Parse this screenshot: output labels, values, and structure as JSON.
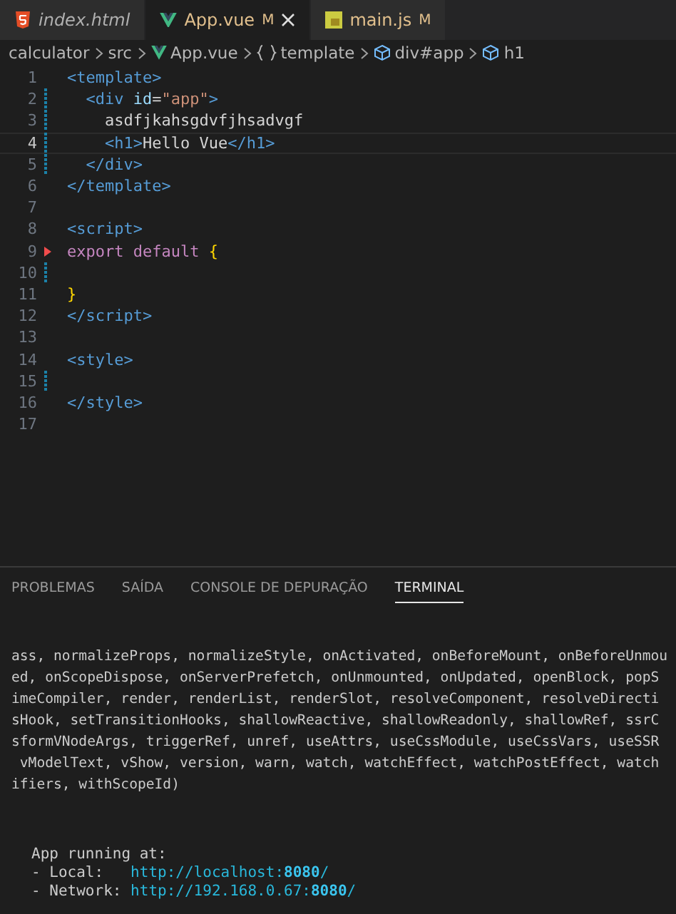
{
  "tabs": [
    {
      "label": "index.html",
      "kind": "html",
      "selected": false,
      "preview": true,
      "closable": false
    },
    {
      "label": "App.vue",
      "kind": "vue",
      "selected": true,
      "preview": false,
      "badge": "M",
      "closable": true
    },
    {
      "label": "main.js",
      "kind": "js",
      "selected": false,
      "preview": false,
      "badge": "M",
      "closable": false
    }
  ],
  "breadcrumb": [
    {
      "label": "calculator",
      "kind": "folder"
    },
    {
      "label": "src",
      "kind": "folder"
    },
    {
      "label": "App.vue",
      "kind": "vue"
    },
    {
      "label": "template",
      "kind": "braces"
    },
    {
      "label": "div#app",
      "kind": "cube"
    },
    {
      "label": "h1",
      "kind": "cube"
    }
  ],
  "code_lines": [
    {
      "number": "1",
      "current": false,
      "modified": false,
      "deleted": false,
      "tokens": [
        {
          "kind": "tag",
          "text": "<template>"
        }
      ]
    },
    {
      "number": "2",
      "current": false,
      "modified": true,
      "deleted": false,
      "tokens": [
        {
          "kind": "tag",
          "text": "  <div "
        },
        {
          "kind": "attr",
          "text": "id"
        },
        {
          "kind": "plain",
          "text": "="
        },
        {
          "kind": "string",
          "text": "\"app\""
        },
        {
          "kind": "tag",
          "text": ">"
        }
      ]
    },
    {
      "number": "3",
      "current": false,
      "modified": true,
      "deleted": false,
      "tokens": [
        {
          "kind": "plain",
          "text": "    asdfjkahsgdvfjhsadvgf"
        }
      ]
    },
    {
      "number": "4",
      "current": true,
      "modified": true,
      "deleted": false,
      "tokens": [
        {
          "kind": "tag",
          "text": "    <h1>"
        },
        {
          "kind": "plain",
          "text": "Hello Vue"
        },
        {
          "kind": "tag",
          "text": "</h1>"
        }
      ]
    },
    {
      "number": "5",
      "current": false,
      "modified": true,
      "deleted": false,
      "tokens": [
        {
          "kind": "tag",
          "text": "  </div>"
        }
      ]
    },
    {
      "number": "6",
      "current": false,
      "modified": false,
      "deleted": false,
      "tokens": [
        {
          "kind": "tag",
          "text": "</template>"
        }
      ]
    },
    {
      "number": "7",
      "current": false,
      "modified": false,
      "deleted": false
    },
    {
      "number": "8",
      "current": false,
      "modified": false,
      "deleted": false,
      "tokens": [
        {
          "kind": "tag",
          "text": "<script>"
        }
      ]
    },
    {
      "number": "9",
      "current": false,
      "modified": false,
      "deleted": true,
      "tokens": [
        {
          "kind": "keyword",
          "text": "export default "
        },
        {
          "kind": "brace",
          "text": "{"
        }
      ]
    },
    {
      "number": "10",
      "current": false,
      "modified": true,
      "deleted": false
    },
    {
      "number": "11",
      "current": false,
      "modified": false,
      "deleted": false,
      "tokens": [
        {
          "kind": "brace",
          "text": "}"
        }
      ]
    },
    {
      "number": "12",
      "current": false,
      "modified": false,
      "deleted": false,
      "tokens": [
        {
          "kind": "tag",
          "text": "</script>"
        }
      ]
    },
    {
      "number": "13",
      "current": false,
      "modified": false,
      "deleted": false
    },
    {
      "number": "14",
      "current": false,
      "modified": false,
      "deleted": false,
      "tokens": [
        {
          "kind": "tag",
          "text": "<style>"
        }
      ]
    },
    {
      "number": "15",
      "current": false,
      "modified": true,
      "deleted": false
    },
    {
      "number": "16",
      "current": false,
      "modified": false,
      "deleted": false,
      "tokens": [
        {
          "kind": "tag",
          "text": "</style>"
        }
      ]
    },
    {
      "number": "17",
      "current": false,
      "modified": false,
      "deleted": false
    }
  ],
  "panel_tabs": [
    {
      "label": "PROBLEMAS",
      "selected": false
    },
    {
      "label": "SAÍDA",
      "selected": false
    },
    {
      "label": "CONSOLE DE DEPURAÇÃO",
      "selected": false
    },
    {
      "label": "TERMINAL",
      "selected": true
    }
  ],
  "terminal_output": [
    "ass, normalizeProps, normalizeStyle, onActivated, onBeforeMount, onBeforeUnmou",
    "ed, onScopeDispose, onServerPrefetch, onUnmounted, onUpdated, openBlock, popS",
    "imeCompiler, render, renderList, renderSlot, resolveComponent, resolveDirecti",
    "sHook, setTransitionHooks, shallowReactive, shallowReadonly, shallowRef, ssrC",
    "sformVNodeArgs, triggerRef, unref, useAttrs, useCssModule, useCssVars, useSSR",
    " vModelText, vShow, version, warn, watch, watchEffect, watchPostEffect, watch",
    "ifiers, withScopeId)"
  ],
  "server_info": {
    "heading": "App running at:",
    "entries": [
      {
        "label": "- Local:   ",
        "url_prefix": "http://localhost:",
        "port": "8080",
        "url_suffix": "/"
      },
      {
        "label": "- Network: ",
        "url_prefix": "http://192.168.0.67:",
        "port": "8080",
        "url_suffix": "/"
      }
    ]
  }
}
